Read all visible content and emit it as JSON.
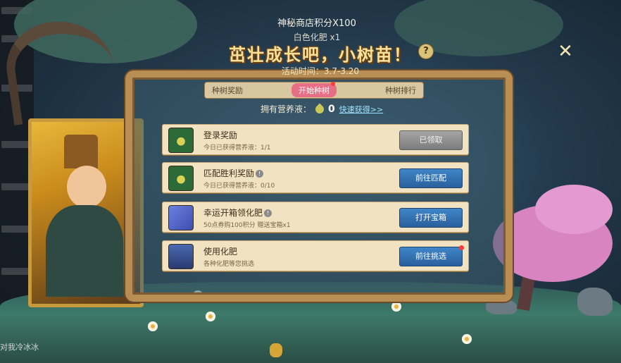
{
  "header": {
    "shop_points": "神秘商店积分X100",
    "fertilizer": "白色化肥 x1",
    "title": "茁壮成长吧，小树苗！",
    "date": "活动时间：3.7-3.20",
    "help": "?",
    "close": "✕"
  },
  "tabs": [
    {
      "label": "种树奖励"
    },
    {
      "label": "开始种树"
    },
    {
      "label": "种树排行"
    }
  ],
  "nutrient": {
    "label": "拥有营养液：",
    "count": "0",
    "link": "快速获得>>"
  },
  "tasks": [
    {
      "title": "登录奖励",
      "desc": "今日已获得营养液：1/1",
      "button": "已领取",
      "icon": "nutrient-bottle-icon"
    },
    {
      "title": "匹配胜利奖励",
      "desc": "今日已获得营养液：0/10",
      "button": "前往匹配",
      "icon": "nutrient-bottle-icon"
    },
    {
      "title": "幸运开箱领化肥",
      "desc": "50点券购100积分 赠送宝箱x1",
      "button": "打开宝箱",
      "icon": "gift-box-icon"
    },
    {
      "title": "使用化肥",
      "desc": "各种化肥等您挑选",
      "button": "前往挑选",
      "icon": "treasure-chest-icon"
    }
  ],
  "sidebar_left": {
    "bottom_text": "对我冷冰冰"
  },
  "colors": {
    "accent_blue": "#2a5f9c",
    "accent_pink": "#e66e85",
    "frame_wood": "#b98e55",
    "title_gold": "#f6e29b"
  }
}
